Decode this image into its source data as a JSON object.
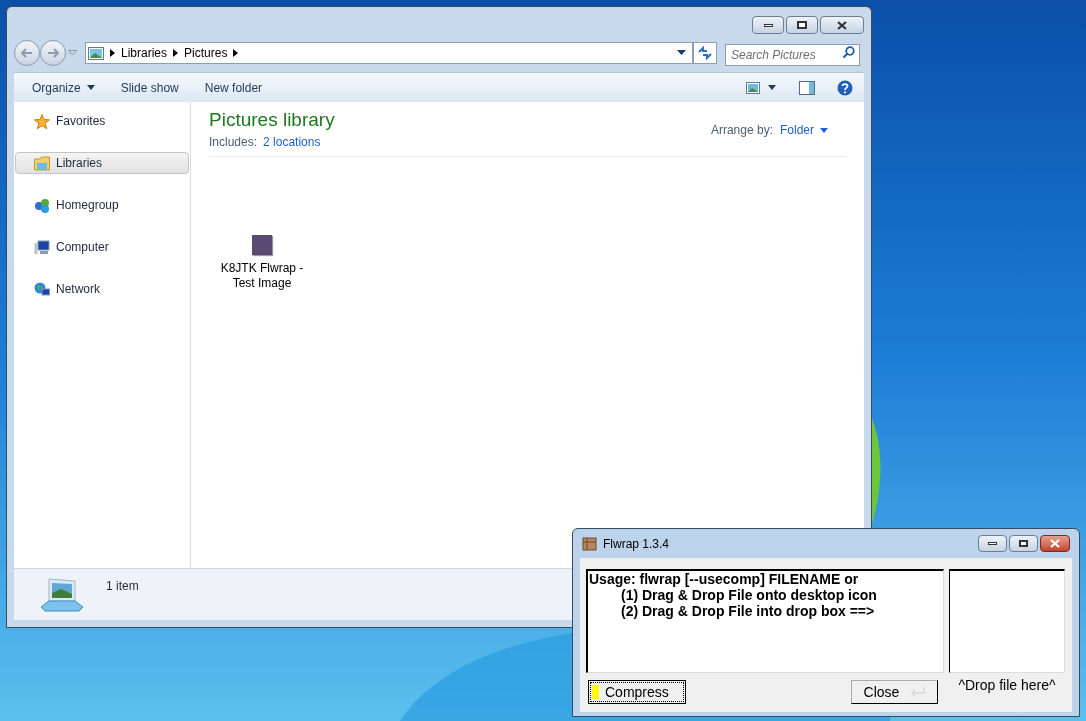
{
  "explorer": {
    "breadcrumb": [
      "Libraries",
      "Pictures"
    ],
    "search": {
      "placeholder": "Search Pictures"
    },
    "toolbar": [
      {
        "label": "Organize",
        "dropdown": true
      },
      {
        "label": "Slide show",
        "dropdown": false
      },
      {
        "label": "New folder",
        "dropdown": false
      }
    ],
    "sidebar": {
      "items": [
        {
          "kind": "favorites",
          "label": "Favorites",
          "selected": false
        },
        {
          "kind": "libraries",
          "label": "Libraries",
          "selected": true
        },
        {
          "kind": "homegroup",
          "label": "Homegroup",
          "selected": false
        },
        {
          "kind": "computer",
          "label": "Computer",
          "selected": false
        },
        {
          "kind": "network",
          "label": "Network",
          "selected": false
        }
      ]
    },
    "library": {
      "title": "Pictures library",
      "includes_label": "Includes:",
      "includes_link": "2 locations",
      "arrange_label": "Arrange by:",
      "arrange_value": "Folder"
    },
    "files": [
      {
        "name": "K8JTK Flwrap - Test Image"
      }
    ],
    "status_bar": {
      "count": "1 item"
    }
  },
  "flwrap": {
    "title": "Flwrap 1.3.4",
    "usage": [
      {
        "text": "Usage: flwrap [--usecomp] FILENAME or",
        "children": [
          {
            "text": "(1) Drag & Drop File onto desktop icon"
          },
          {
            "text": "(2) Drag & Drop File into drop box ==>"
          }
        ]
      }
    ],
    "compress_button": {
      "label": "Compress",
      "on": true
    },
    "close_button": "Close",
    "drop_label": "^Drop file here^"
  }
}
